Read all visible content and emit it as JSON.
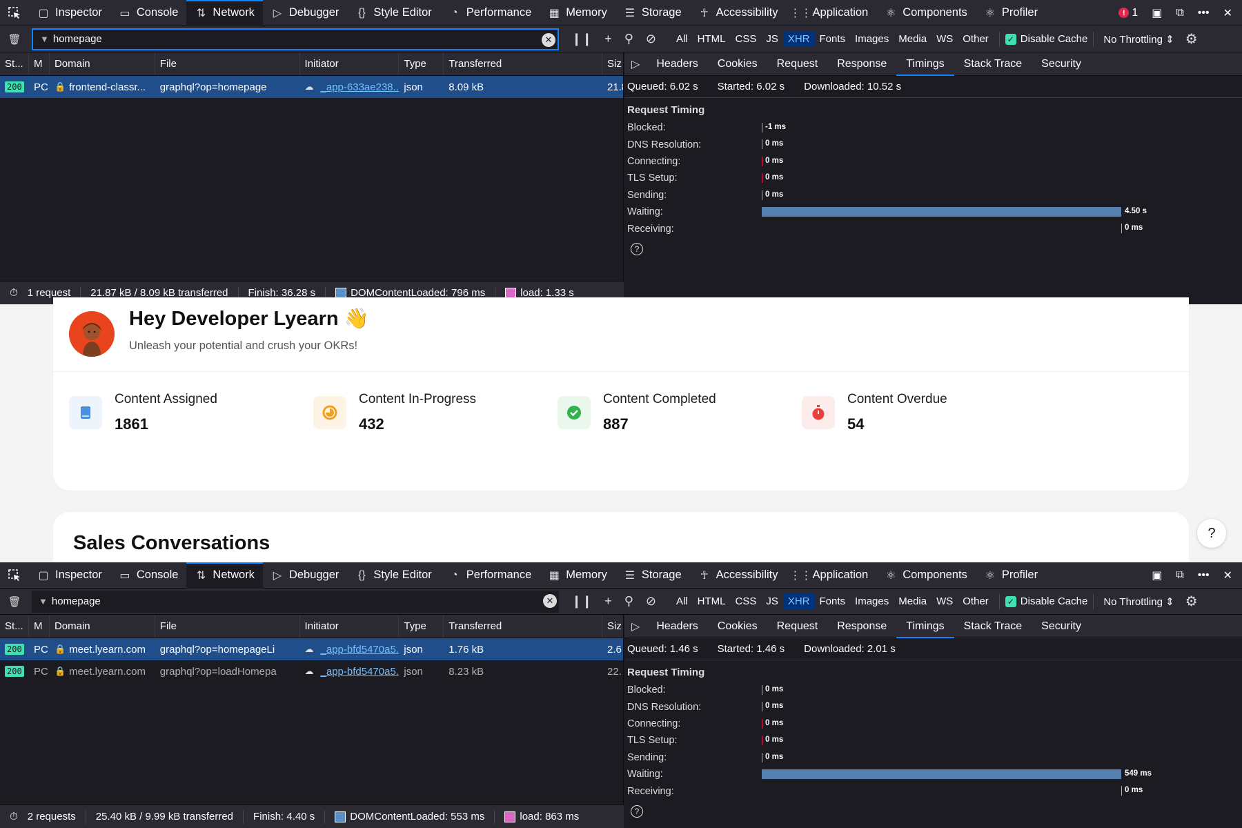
{
  "devtools_tabs": [
    "Inspector",
    "Console",
    "Network",
    "Debugger",
    "Style Editor",
    "Performance",
    "Memory",
    "Storage",
    "Accessibility",
    "Application",
    "Components",
    "Profiler"
  ],
  "devtools_tab_icons": [
    "inspector-icon",
    "console-icon",
    "network-icon",
    "debugger-icon",
    "style-editor-icon",
    "performance-icon",
    "memory-icon",
    "storage-icon",
    "accessibility-icon",
    "application-icon",
    "components-icon",
    "profiler-icon"
  ],
  "error_count": "1",
  "type_filters": [
    "All",
    "HTML",
    "CSS",
    "JS",
    "XHR",
    "Fonts",
    "Images",
    "Media",
    "WS",
    "Other"
  ],
  "active_type": "XHR",
  "disable_cache_label": "Disable Cache",
  "throttling_label": "No Throttling",
  "columns": [
    "St...",
    "M",
    "Domain",
    "File",
    "Initiator",
    "Type",
    "Transferred",
    "Siz"
  ],
  "detail_tabs": [
    "Headers",
    "Cookies",
    "Request",
    "Response",
    "Timings",
    "Stack Trace",
    "Security"
  ],
  "active_detail_tab": "Timings",
  "timing_title": "Request Timing",
  "timing_labels": [
    "Blocked:",
    "DNS Resolution:",
    "Connecting:",
    "TLS Setup:",
    "Sending:",
    "Waiting:",
    "Receiving:"
  ],
  "top": {
    "filter_value": "homepage",
    "requests": [
      {
        "status": "200",
        "method": "PC",
        "domain": "frontend-classr...",
        "file": "graphql?op=homepage",
        "initiator": "_app-633ae238...",
        "type": "json",
        "transferred": "8.09 kB",
        "size": "21.8",
        "selected": true
      }
    ],
    "status_bar": {
      "requests": "1 request",
      "sizes": "21.87 kB / 8.09 kB transferred",
      "finish": "Finish: 36.28 s",
      "dcl": "DOMContentLoaded: 796 ms",
      "load": "load: 1.33 s"
    },
    "summary": {
      "queued": "Queued: 6.02 s",
      "started": "Started: 6.02 s",
      "downloaded": "Downloaded: 10.52 s"
    },
    "timings": [
      "-1 ms",
      "0 ms",
      "0 ms",
      "0 ms",
      "0 ms",
      "4.50 s",
      "0 ms"
    ]
  },
  "page": {
    "greeting": "Hey Developer Lyearn",
    "greeting_emoji": "👋",
    "subtitle": "Unleash your potential and crush your OKRs!",
    "stats": [
      {
        "label": "Content Assigned",
        "value": "1861",
        "icon": "book-icon",
        "color": "#4a90e2",
        "bg": "#eef4fc"
      },
      {
        "label": "Content In-Progress",
        "value": "432",
        "icon": "progress-icon",
        "color": "#f0a020",
        "bg": "#fdf4e6"
      },
      {
        "label": "Content Completed",
        "value": "887",
        "icon": "check-circle-icon",
        "color": "#2fb34a",
        "bg": "#eaf7ed"
      },
      {
        "label": "Content Overdue",
        "value": "54",
        "icon": "timer-icon",
        "color": "#e8403a",
        "bg": "#fdecec"
      }
    ],
    "section_title": "Sales Conversations",
    "help_label": "?"
  },
  "bottom": {
    "filter_value": "homepage",
    "requests": [
      {
        "status": "200",
        "method": "PC",
        "domain": "meet.lyearn.com",
        "file": "graphql?op=homepageLi",
        "initiator": "_app-bfd5470a5...",
        "type": "json",
        "transferred": "1.76 kB",
        "size": "2.6",
        "selected": true
      },
      {
        "status": "200",
        "method": "PC",
        "domain": "meet.lyearn.com",
        "file": "graphql?op=loadHomepa",
        "initiator": "_app-bfd5470a5...",
        "type": "json",
        "transferred": "8.23 kB",
        "size": "22.",
        "selected": false
      }
    ],
    "status_bar": {
      "requests": "2 requests",
      "sizes": "25.40 kB / 9.99 kB transferred",
      "finish": "Finish: 4.40 s",
      "dcl": "DOMContentLoaded: 553 ms",
      "load": "load: 863 ms"
    },
    "summary": {
      "queued": "Queued: 1.46 s",
      "started": "Started: 1.46 s",
      "downloaded": "Downloaded: 2.01 s"
    },
    "timings": [
      "0 ms",
      "0 ms",
      "0 ms",
      "0 ms",
      "0 ms",
      "549 ms",
      "0 ms"
    ]
  }
}
